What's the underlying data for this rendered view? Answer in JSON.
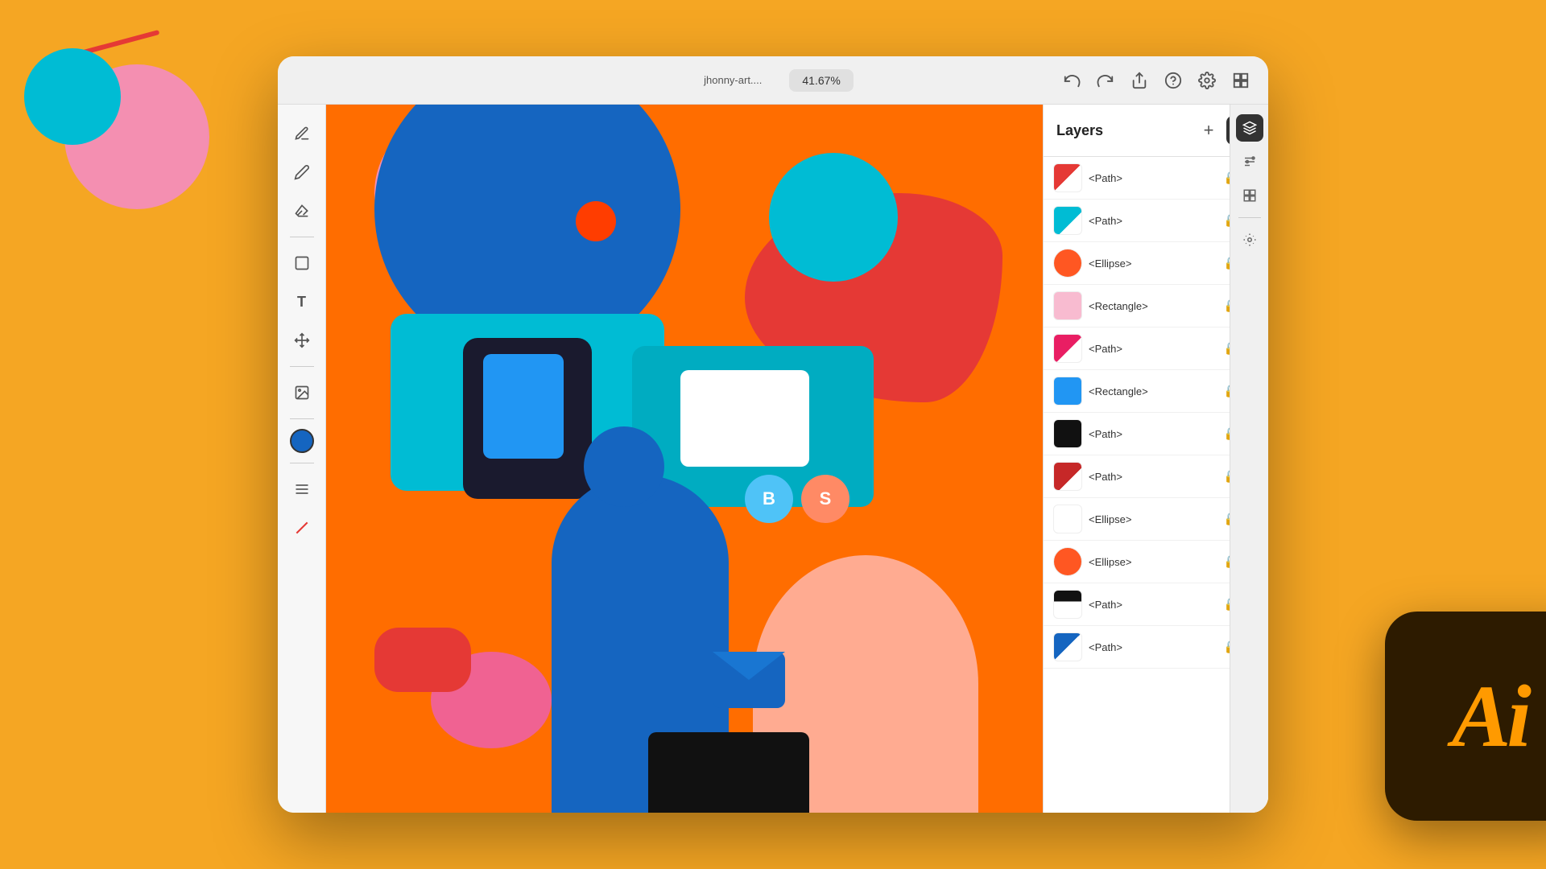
{
  "background": {
    "color": "#F5A623"
  },
  "titlebar": {
    "tab_label": "jhonny-art....",
    "zoom_label": "41.67%",
    "undo_label": "undo",
    "redo_label": "redo",
    "share_label": "share",
    "help_label": "help",
    "settings_label": "settings",
    "arrange_label": "arrange"
  },
  "layers_panel": {
    "title": "Layers",
    "add_button_label": "+",
    "items": [
      {
        "name": "<Path>",
        "color": "#E53935",
        "type": "path",
        "shape": "path-red"
      },
      {
        "name": "<Path>",
        "color": "#00BCD4",
        "type": "path",
        "shape": "path-teal"
      },
      {
        "name": "<Ellipse>",
        "color": "#FF5722",
        "type": "ellipse",
        "shape": "ellipse-orange"
      },
      {
        "name": "<Rectangle>",
        "color": "#F8BBD0",
        "type": "rectangle",
        "shape": "rect-pink"
      },
      {
        "name": "<Path>",
        "color": "#E91E63",
        "type": "path",
        "shape": "path-pink"
      },
      {
        "name": "<Rectangle>",
        "color": "#2196F3",
        "type": "rectangle",
        "shape": "rect-blue"
      },
      {
        "name": "<Path>",
        "color": "#111111",
        "type": "path",
        "shape": "path-black"
      },
      {
        "name": "<Path>",
        "color": "#C62828",
        "type": "path",
        "shape": "path-darkred"
      },
      {
        "name": "<Ellipse>",
        "color": "#FFFFFF",
        "type": "ellipse",
        "shape": "ellipse-white"
      },
      {
        "name": "<Ellipse>",
        "color": "#FF5722",
        "type": "ellipse",
        "shape": "ellipse-orange2"
      },
      {
        "name": "<Path>",
        "color": "#111111",
        "type": "path",
        "shape": "path-black2"
      },
      {
        "name": "<Path>",
        "color": "#1565C0",
        "type": "path",
        "shape": "path-blue"
      }
    ]
  },
  "toolbar": {
    "tools": [
      {
        "name": "pen-tool",
        "icon": "✒"
      },
      {
        "name": "pencil-tool",
        "icon": "✏"
      },
      {
        "name": "eraser-tool",
        "icon": "◻"
      },
      {
        "name": "shape-tool",
        "icon": "▭"
      },
      {
        "name": "text-tool",
        "icon": "T"
      },
      {
        "name": "transform-tool",
        "icon": "⊹"
      },
      {
        "name": "image-tool",
        "icon": "🖼"
      }
    ],
    "color": "#1565C0"
  },
  "ai_logo": {
    "text": "Ai",
    "background": "#2D1B00",
    "color": "#FF9A00"
  },
  "badges": [
    {
      "id": "badge-b",
      "label": "B",
      "color": "#4FC3F7"
    },
    {
      "id": "badge-s",
      "label": "S",
      "color": "#FF8A65"
    }
  ]
}
